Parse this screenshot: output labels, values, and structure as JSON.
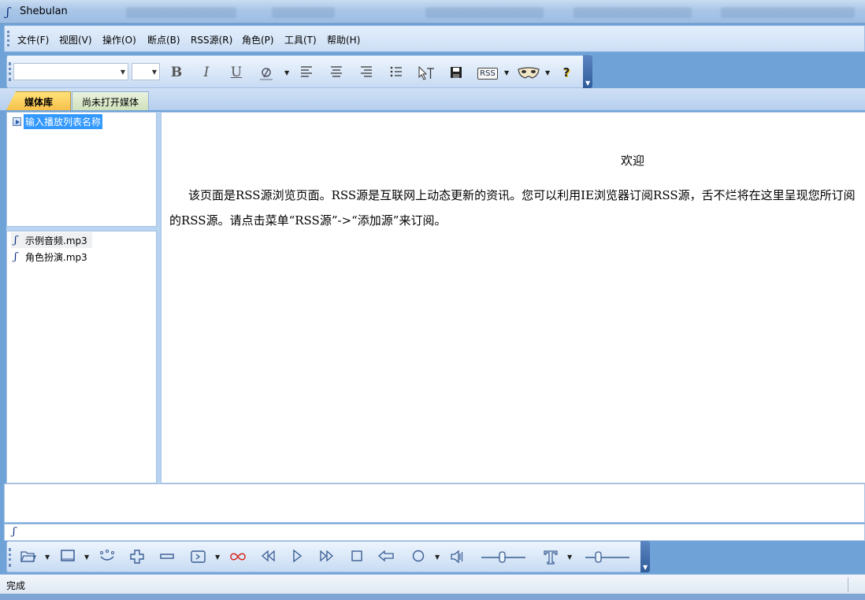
{
  "window": {
    "title": "Shebulan"
  },
  "menu": {
    "items": [
      "文件(F)",
      "视图(V)",
      "操作(O)",
      "断点(B)",
      "RSS源(R)",
      "角色(P)",
      "工具(T)",
      "帮助(H)"
    ]
  },
  "format_toolbar": {
    "font_value": "",
    "size_value": "",
    "bold": "B",
    "italic": "I",
    "underline": "U",
    "rss_button": "RSS",
    "help": "?"
  },
  "tabs": [
    {
      "label": "媒体库",
      "active": true
    },
    {
      "label": "尚未打开媒体",
      "active": false
    }
  ],
  "playlist": {
    "placeholder_item": "输入播放列表名称"
  },
  "files": [
    {
      "name": "示例音频.mp3"
    },
    {
      "name": "角色扮演.mp3"
    }
  ],
  "document": {
    "heading": "欢迎",
    "paragraph": "该页面是RSS源浏览页面。RSS源是互联网上动态更新的资讯。您可以利用IE浏览器订阅RSS源，舌不烂将在这里呈现您所订阅的RSS源。请点击菜单“RSS源”->“添加源”来订阅。"
  },
  "status": {
    "text": "完成"
  },
  "colors": {
    "accent": "#3399ff",
    "tab_active": "#f7c04a",
    "toolbar_blue": "#c8dbf3",
    "link_red": "#d9261c"
  }
}
